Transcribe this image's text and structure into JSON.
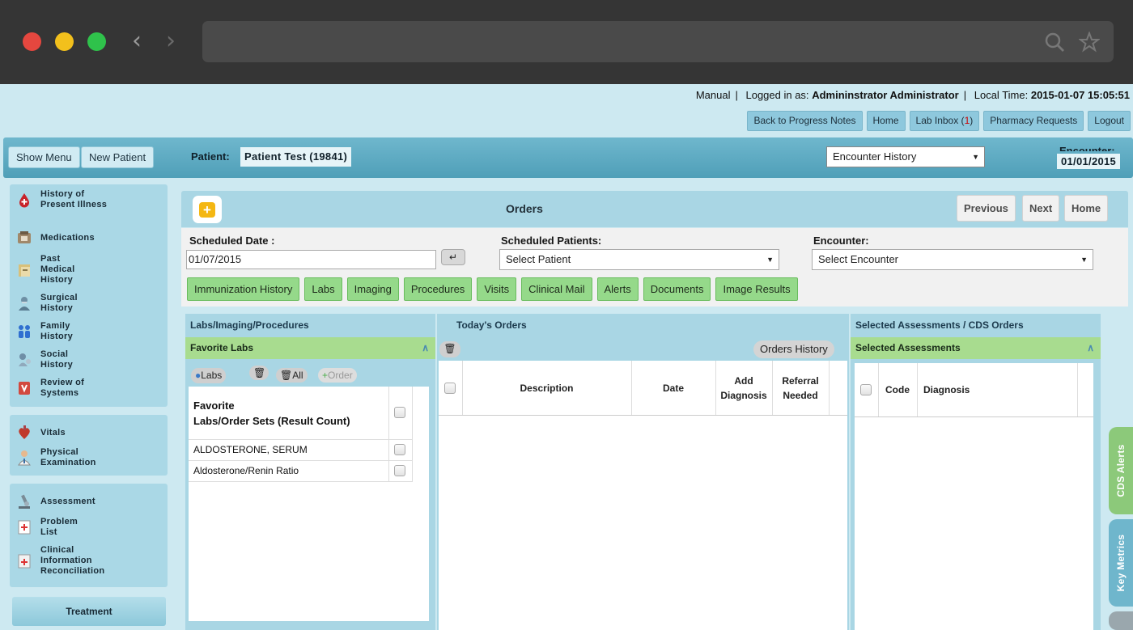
{
  "header": {
    "mode": "Manual",
    "logged_in_label": "Logged in as:",
    "user": "Admininstrator Administrator",
    "local_time_label": "Local Time:",
    "local_time": "2015-01-07 15:05:51"
  },
  "top_links": {
    "back": "Back to Progress Notes",
    "home": "Home",
    "lab_inbox": "Lab Inbox (",
    "lab_inbox_count": "1",
    "lab_inbox_end": ")",
    "pharmacy": "Pharmacy Requests",
    "logout": "Logout"
  },
  "patient_bar": {
    "show_menu": "Show Menu",
    "new_patient": "New Patient",
    "patient_label": "Patient:",
    "patient_name": "Patient Test (19841)",
    "encounter_history": "Encounter History",
    "encounter_label": "Encounter:",
    "encounter_date": "01/01/2015"
  },
  "sidebar": {
    "group1": [
      {
        "label": "History of Present Illness",
        "icon": "blood-drop-icon"
      },
      {
        "label": "Medications",
        "icon": "medications-icon"
      },
      {
        "label": "Past Medical History",
        "icon": "medical-records-icon"
      },
      {
        "label": "Surgical History",
        "icon": "surgeon-icon"
      },
      {
        "label": "Family History",
        "icon": "family-icon"
      },
      {
        "label": "Social History",
        "icon": "social-icon"
      },
      {
        "label": "Review of Systems",
        "icon": "review-systems-icon"
      }
    ],
    "group2": [
      {
        "label": "Vitals",
        "icon": "heart-icon"
      },
      {
        "label": "Physical Examination",
        "icon": "doctor-icon"
      }
    ],
    "group3": [
      {
        "label": "Assessment",
        "icon": "microscope-icon"
      },
      {
        "label": "Problem List",
        "icon": "problem-list-icon"
      },
      {
        "label": "Clinical Information Reconciliation",
        "icon": "reconciliation-icon"
      }
    ],
    "treatment": "Treatment"
  },
  "orders": {
    "title": "Orders",
    "nav": {
      "previous": "Previous",
      "next": "Next",
      "home": "Home"
    },
    "scheduled_date_label": "Scheduled Date :",
    "scheduled_date": "01/07/2015",
    "scheduled_patients_label": "Scheduled Patients:",
    "select_patient": "Select Patient",
    "encounter_label": "Encounter:",
    "select_encounter": "Select Encounter",
    "tabs": [
      "Immunization History",
      "Labs",
      "Imaging",
      "Procedures",
      "Visits",
      "Clinical Mail",
      "Alerts",
      "Documents",
      "Image Results"
    ]
  },
  "labs_panel": {
    "title": "Labs/Imaging/Procedures",
    "favorite_title": "Favorite Labs",
    "btn_labs": "Labs",
    "btn_all": "All",
    "btn_order": "Order",
    "col_header_line1": "Favorite",
    "col_header_line2": "Labs/Order Sets (Result Count)",
    "rows": [
      "ALDOSTERONE, SERUM",
      "Aldosterone/Renin Ratio"
    ]
  },
  "todays_orders": {
    "title": "Today's Orders",
    "history_btn": "Orders History",
    "columns": {
      "description": "Description",
      "date": "Date",
      "add_line1": "Add",
      "add_line2": "Diagnosis",
      "ref_line1": "Referral",
      "ref_line2": "Needed"
    }
  },
  "assessments": {
    "title": "Selected Assessments / CDS Orders",
    "sub_title": "Selected Assessments",
    "columns": {
      "code": "Code",
      "diagnosis": "Diagnosis"
    }
  },
  "side_tabs": {
    "cds": "CDS Alerts",
    "metrics": "Key Metrics"
  }
}
